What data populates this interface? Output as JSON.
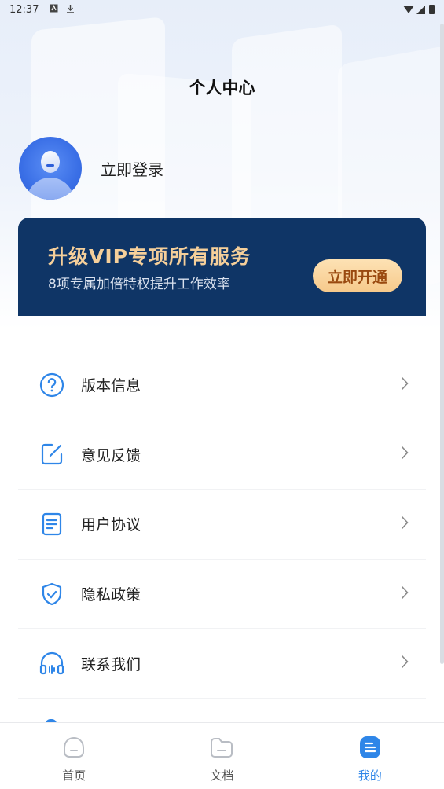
{
  "status_bar": {
    "time": "12:37",
    "icons": [
      "a-box-icon",
      "download-icon",
      "wifi-icon",
      "signal-icon",
      "battery-icon"
    ]
  },
  "header": {
    "title": "个人中心"
  },
  "profile": {
    "login_label": "立即登录"
  },
  "vip_banner": {
    "title": "升级VIP专项所有服务",
    "subtitle": "8项专属加倍特权提升工作效率",
    "button_label": "立即开通",
    "colors": {
      "background": "#0f3566",
      "title": "#f5cf9a",
      "button": "#f6c98b"
    }
  },
  "menu": {
    "items": [
      {
        "label": "版本信息",
        "icon": "question-circle-icon"
      },
      {
        "label": "意见反馈",
        "icon": "edit-square-icon"
      },
      {
        "label": "用户协议",
        "icon": "document-icon"
      },
      {
        "label": "隐私政策",
        "icon": "shield-check-icon"
      },
      {
        "label": "联系我们",
        "icon": "headset-icon"
      }
    ]
  },
  "bottom_nav": {
    "items": [
      {
        "label": "首页",
        "icon": "home-icon",
        "active": false
      },
      {
        "label": "文档",
        "icon": "folder-icon",
        "active": false
      },
      {
        "label": "我的",
        "icon": "profile-doc-icon",
        "active": true
      }
    ]
  },
  "colors": {
    "accent": "#2f86e8",
    "inactive_icon": "#b9bdc4"
  }
}
